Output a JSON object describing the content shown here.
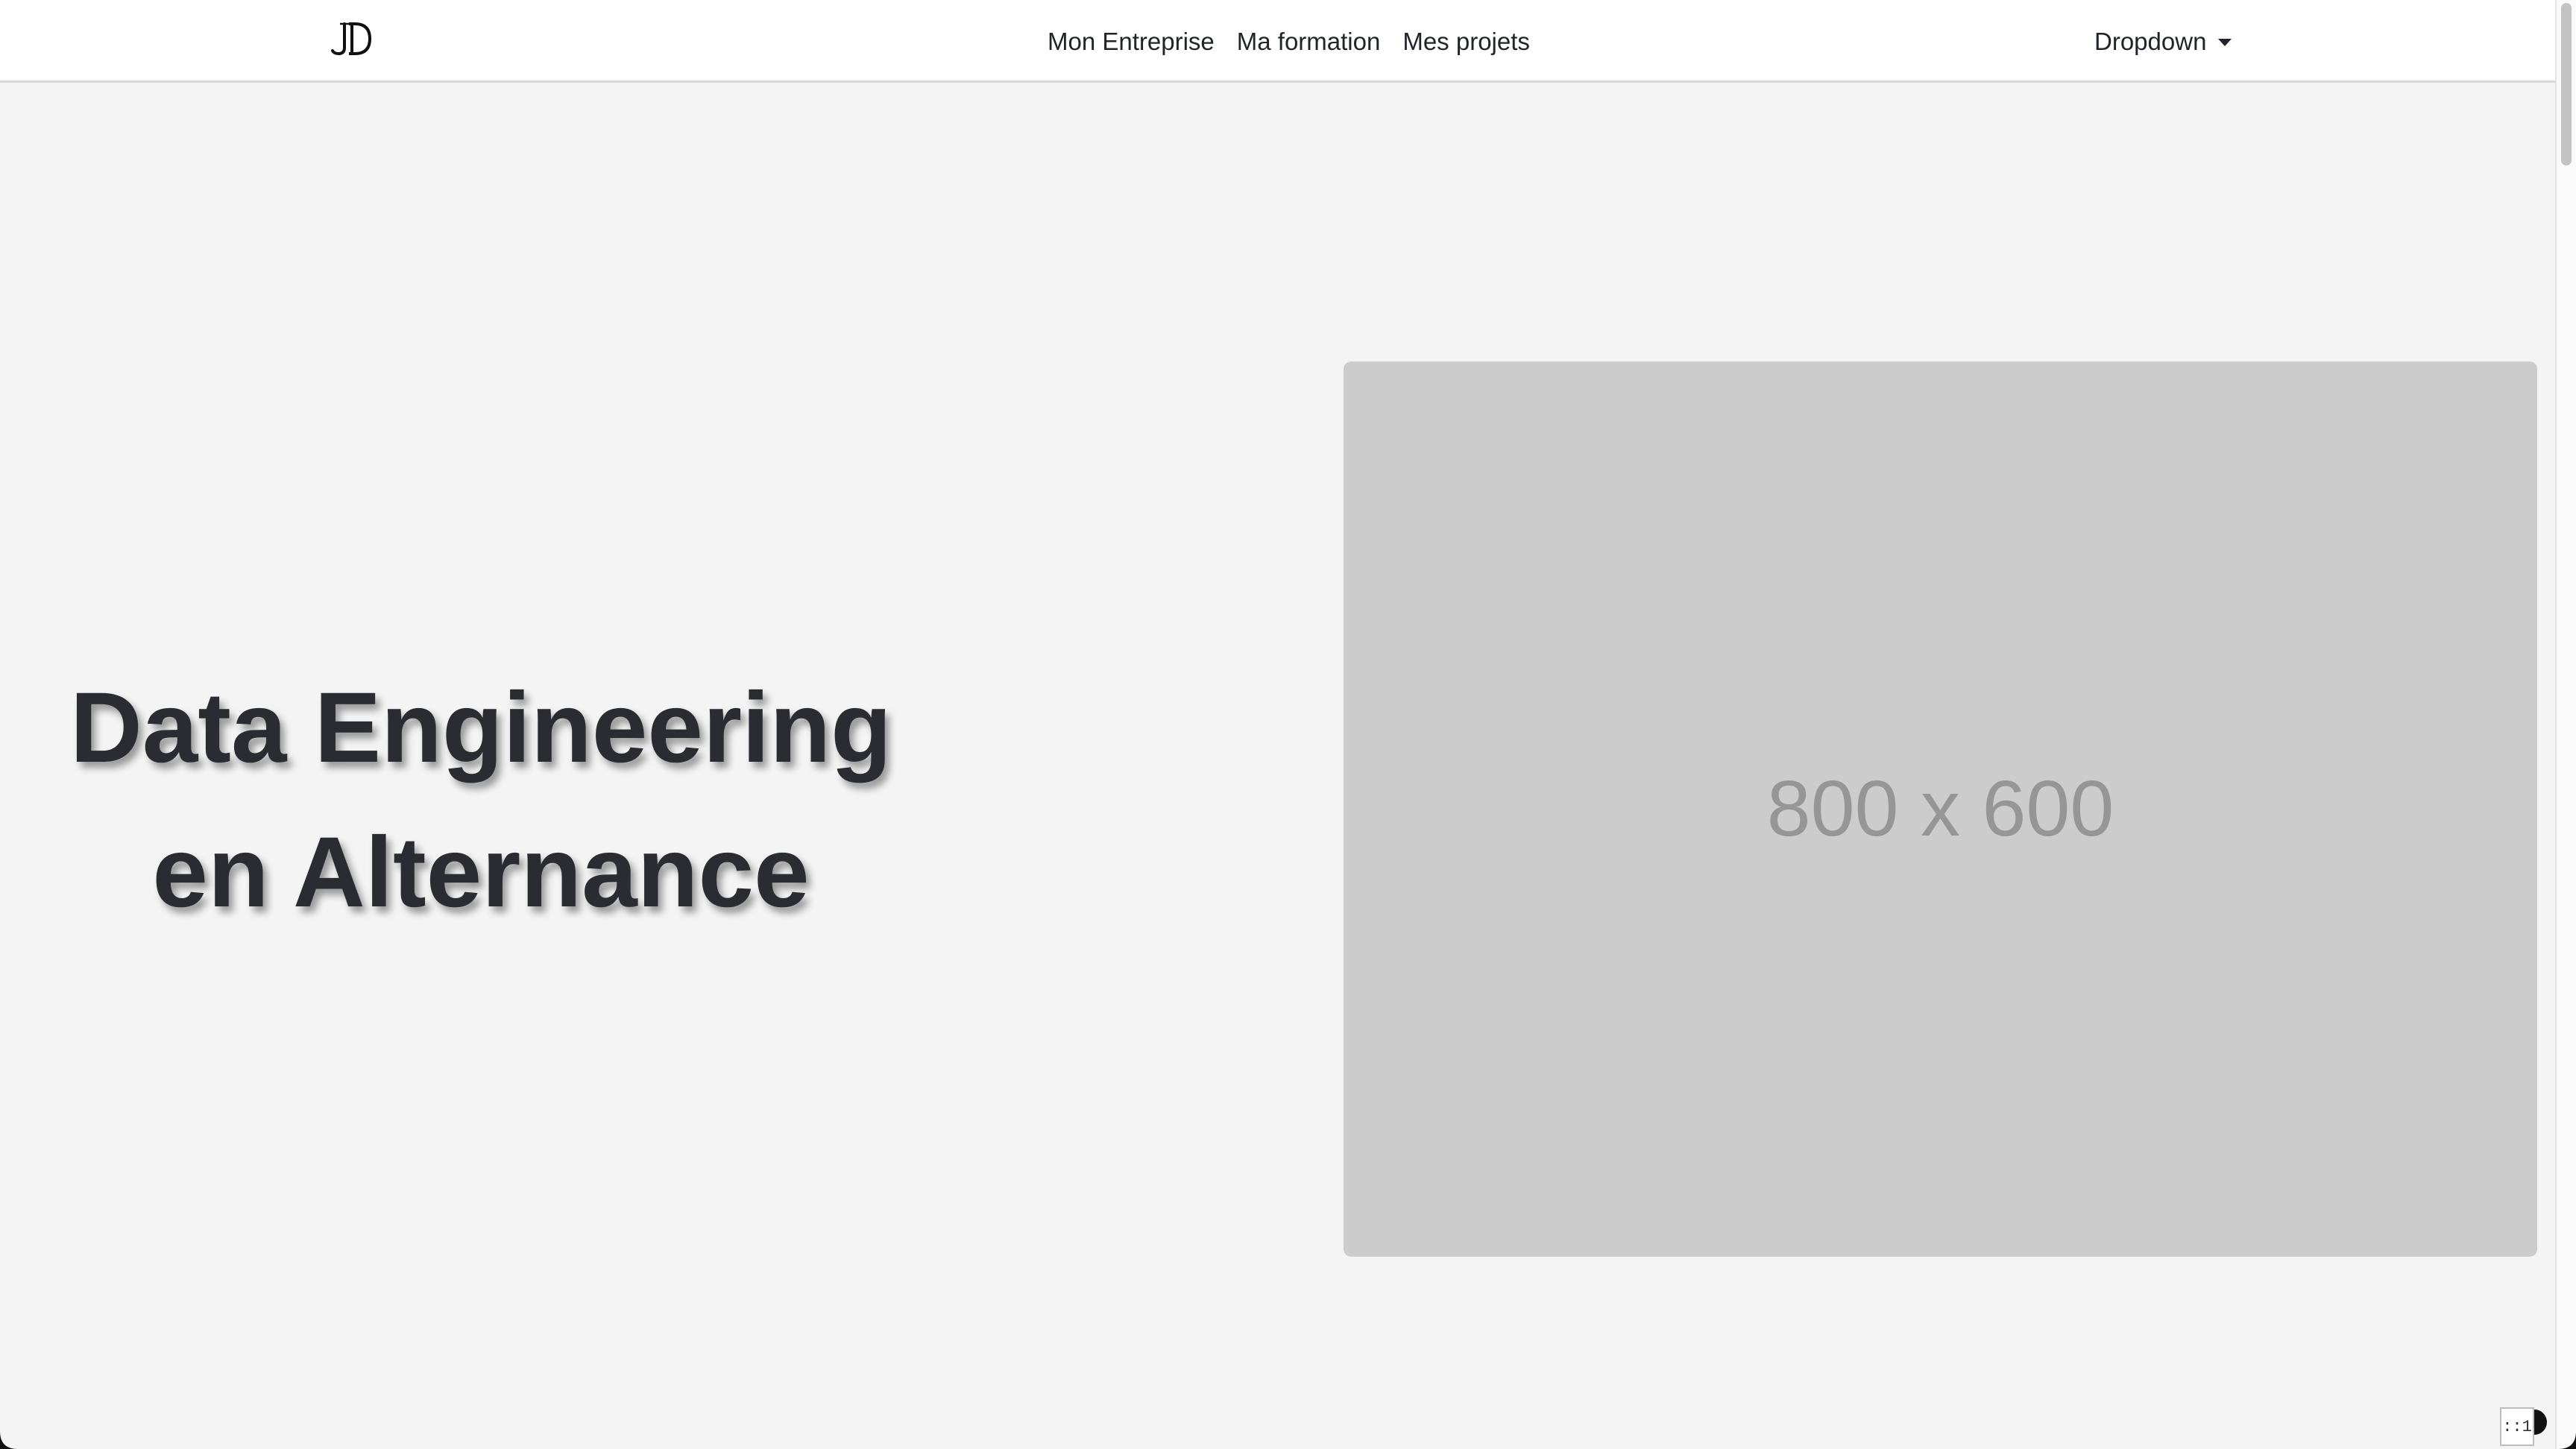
{
  "navbar": {
    "brand_logo": "JD-logo",
    "links": [
      {
        "label": "Mon Entreprise"
      },
      {
        "label": "Ma formation"
      },
      {
        "label": "Mes projets"
      }
    ],
    "dropdown": {
      "label": "Dropdown",
      "icon": "caret-down-icon"
    }
  },
  "hero": {
    "title_line1": "Data Engineering",
    "title_line2": "en Alternance",
    "image_placeholder": {
      "label": "800 x 600",
      "background": "#cccccc",
      "text_color": "#969696"
    }
  },
  "corner_widget": {
    "label": "::1",
    "icon": "contrast-icon"
  },
  "colors": {
    "page_background": "#f4f4f4",
    "navbar_background": "#ffffff",
    "text": "#212529",
    "title_text": "#2a2c31"
  }
}
